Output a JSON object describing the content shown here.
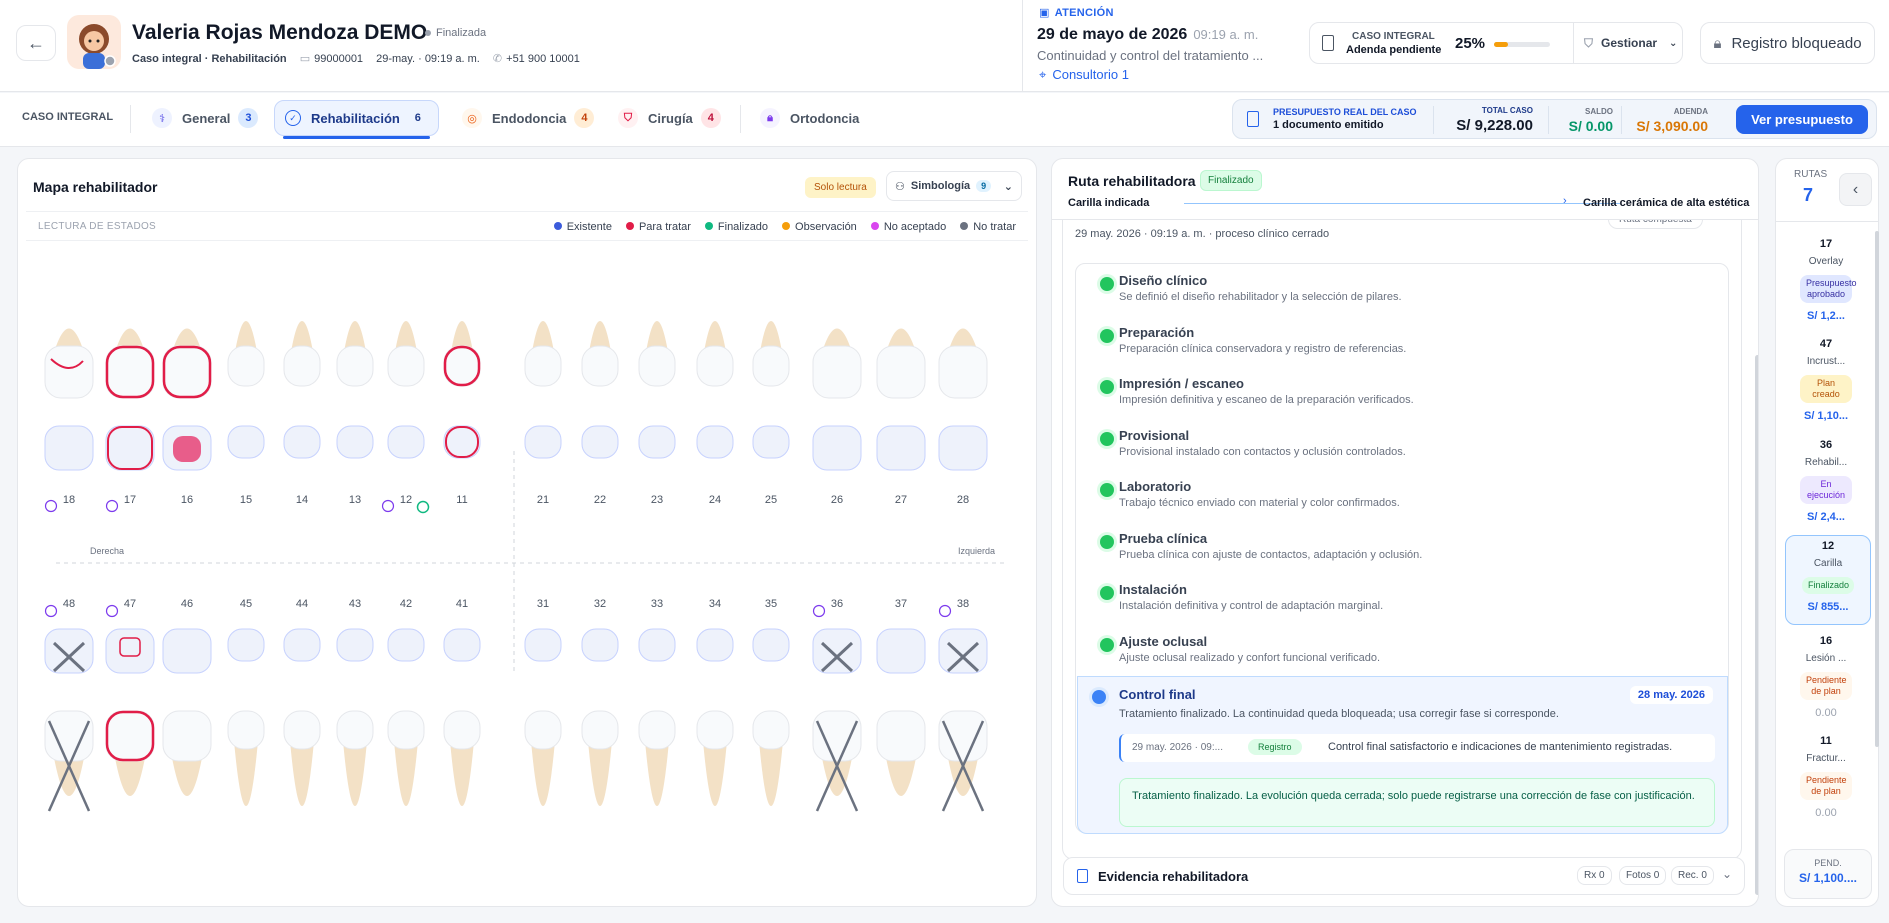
{
  "header": {
    "patient_name": "Valeria Rojas Mendoza DEMO",
    "patient_status": "Finalizada",
    "case_type": "Caso integral · Rehabilitación",
    "patient_id": "99000001",
    "date_time": "29-may. · 09:19 a. m.",
    "phone": "+51 900 10001",
    "attention_label": "ATENCIÓN",
    "attention_date": "29 de mayo de 2026",
    "attention_time": "09:19 a. m.",
    "attention_desc": "Continuidad y control del tratamiento ...",
    "attention_room": "Consultorio 1",
    "case_label": "CASO INTEGRAL",
    "case_sub": "Adenda pendiente",
    "case_progress_text": "25%",
    "case_progress": 0.25,
    "manage_label": "Gestionar",
    "lock_label": "Registro bloqueado"
  },
  "tabs": {
    "case_label": "CASO INTEGRAL",
    "items": [
      {
        "label": "General",
        "count": "3"
      },
      {
        "label": "Rehabilitación",
        "count": "6"
      },
      {
        "label": "Endodoncia",
        "count": "4"
      },
      {
        "label": "Cirugía",
        "count": "4"
      },
      {
        "label": "Ortodoncia",
        "count": ""
      }
    ]
  },
  "budget": {
    "title": "PRESUPUESTO REAL DEL CASO",
    "docs": "1 documento emitido",
    "total_label": "TOTAL CASO",
    "total": "S/ 9,228.00",
    "saldo_label": "SALDO",
    "saldo": "S/ 0.00",
    "adenda_label": "ADENDA",
    "adenda": "S/ 3,090.00",
    "button": "Ver presupuesto"
  },
  "map": {
    "title": "Mapa rehabilitador",
    "readonly": "Solo lectura",
    "symbology": "Simbología",
    "symbology_count": "9",
    "states_label": "LECTURA DE ESTADOS",
    "legend": [
      {
        "label": "Existente",
        "color": "#3b5bdb"
      },
      {
        "label": "Para tratar",
        "color": "#e11d48"
      },
      {
        "label": "Finalizado",
        "color": "#10b981"
      },
      {
        "label": "Observación",
        "color": "#f59e0b"
      },
      {
        "label": "No aceptado",
        "color": "#d946ef"
      },
      {
        "label": "No tratar",
        "color": "#6b7280"
      }
    ],
    "right_label": "Derecha",
    "left_label": "Izquierda",
    "upper_teeth": [
      "18",
      "17",
      "16",
      "15",
      "14",
      "13",
      "12",
      "11",
      "21",
      "22",
      "23",
      "24",
      "25",
      "26",
      "27",
      "28"
    ],
    "lower_teeth": [
      "48",
      "47",
      "46",
      "45",
      "44",
      "43",
      "42",
      "41",
      "31",
      "32",
      "33",
      "34",
      "35",
      "36",
      "37",
      "38"
    ]
  },
  "route": {
    "title": "Ruta rehabilitadora",
    "status": "Finalizado",
    "from": "Carilla indicada",
    "to": "Carilla cerámica de alta estética",
    "meta": "29 may. 2026 · 09:19 a. m. · proceso clínico cerrado",
    "composite": "Ruta compuesta",
    "steps": [
      {
        "title": "Diseño clínico",
        "desc": "Se definió el diseño rehabilitador y la selección de pilares."
      },
      {
        "title": "Preparación",
        "desc": "Preparación clínica conservadora y registro de referencias."
      },
      {
        "title": "Impresión / escaneo",
        "desc": "Impresión definitiva y escaneo de la preparación verificados."
      },
      {
        "title": "Provisional",
        "desc": "Provisional instalado con contactos y oclusión controlados."
      },
      {
        "title": "Laboratorio",
        "desc": "Trabajo técnico enviado con material y color confirmados."
      },
      {
        "title": "Prueba clínica",
        "desc": "Prueba clínica con ajuste de contactos, adaptación y oclusión."
      },
      {
        "title": "Instalación",
        "desc": "Instalación definitiva y control de adaptación marginal."
      },
      {
        "title": "Ajuste oclusal",
        "desc": "Ajuste oclusal realizado y confort funcional verificado."
      }
    ],
    "final": {
      "title": "Control final",
      "date": "28 may. 2026",
      "desc": "Tratamiento finalizado. La continuidad queda bloqueada; usa corregir fase si corresponde.",
      "log_time": "29 may. 2026 · 09:...",
      "log_tag": "Registro",
      "log_text": "Control final satisfactorio e indicaciones de mantenimiento registradas.",
      "notice": "Tratamiento finalizado. La evolución queda cerrada; solo puede registrarse una corrección de fase con justificación."
    },
    "evidence_title": "Evidencia rehabilitadora",
    "evidence_pills": [
      "Rx 0",
      "Fotos 0",
      "Rec. 0"
    ]
  },
  "routes_panel": {
    "label": "RUTAS",
    "count": "7",
    "items": [
      {
        "num": "17",
        "name": "Overlay",
        "badge": "Presupuesto aprobado",
        "value": "S/ 1,2...",
        "badge_bg": "#e0e7ff",
        "badge_fg": "#3730a3"
      },
      {
        "num": "47",
        "name": "Incrust...",
        "badge": "Plan creado",
        "value": "S/ 1,10...",
        "badge_bg": "#fef3c7",
        "badge_fg": "#b45309"
      },
      {
        "num": "36",
        "name": "Rehabil...",
        "badge": "En ejecución",
        "value": "S/ 2,4...",
        "badge_bg": "#ede9fe",
        "badge_fg": "#6d28d9"
      },
      {
        "num": "12",
        "name": "Carilla",
        "badge": "Finalizado",
        "value": "S/ 855...",
        "badge_bg": "#dcfce7",
        "badge_fg": "#15803d"
      },
      {
        "num": "16",
        "name": "Lesión ...",
        "badge": "Pendiente de plan",
        "value": "0.00",
        "badge_bg": "#fff7ed",
        "badge_fg": "#c2410c"
      },
      {
        "num": "11",
        "name": "Fractur...",
        "badge": "Pendiente de plan",
        "value": "0.00",
        "badge_bg": "#fff7ed",
        "badge_fg": "#c2410c"
      }
    ],
    "pend_label": "PEND.",
    "pend_value": "S/ 1,100...."
  }
}
